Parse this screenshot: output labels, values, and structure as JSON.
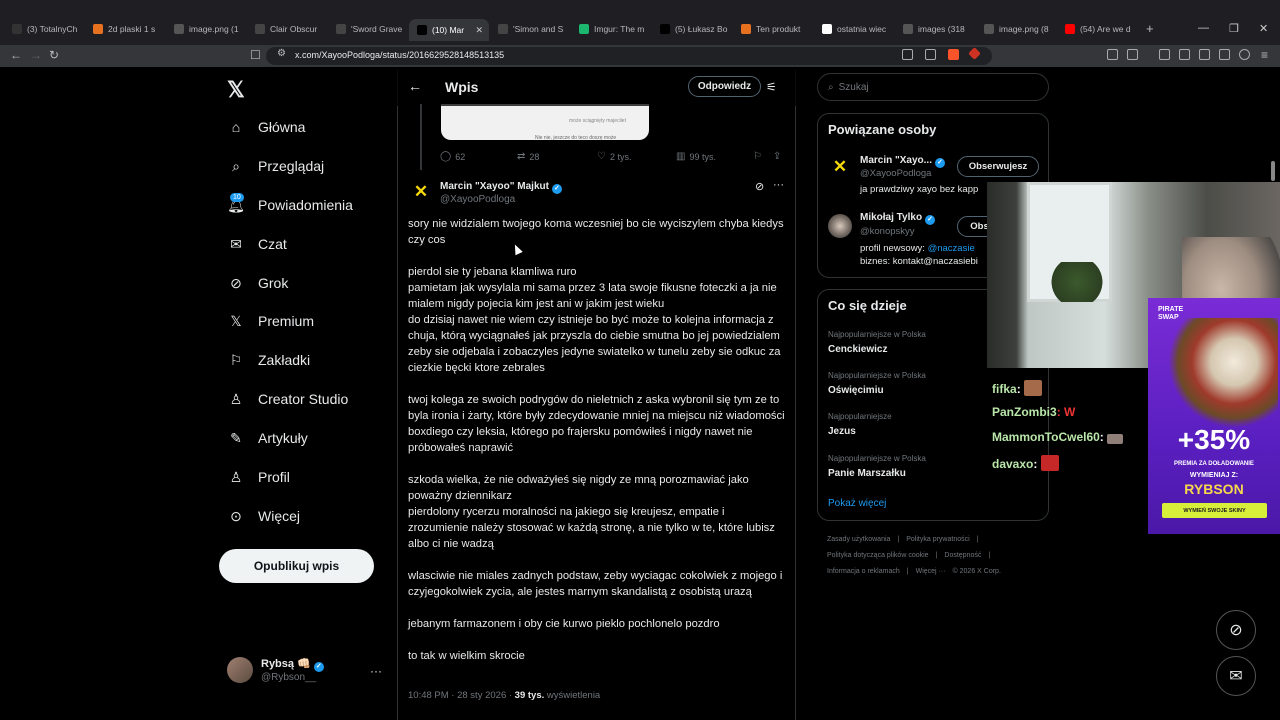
{
  "browser": {
    "tabs": [
      {
        "label": "(3) TotalnyCh",
        "color": "#333"
      },
      {
        "label": "2d plaski 1 s",
        "color": "#e8711f"
      },
      {
        "label": "image.png (1",
        "color": "#555"
      },
      {
        "label": "Clair Obscur",
        "color": "#444"
      },
      {
        "label": "'Sword Grave",
        "color": "#444"
      },
      {
        "label": "(10) Mar",
        "color": "#000"
      },
      {
        "label": "'Simon and S",
        "color": "#444"
      },
      {
        "label": "Imgur: The m",
        "color": "#1bb76e"
      },
      {
        "label": "(5) Łukasz Bo",
        "color": "#000"
      },
      {
        "label": "Ten produkt",
        "color": "#e8711f"
      },
      {
        "label": "ostatnia wiec",
        "color": "#fff"
      },
      {
        "label": "images (318",
        "color": "#555"
      },
      {
        "label": "image.png (8",
        "color": "#555"
      },
      {
        "label": "(54) Are we d",
        "color": "#f00"
      }
    ],
    "url": "x.com/XayooPodloga/status/2016629528148513135"
  },
  "nav": {
    "items": [
      {
        "label": "Główna",
        "icon": "home-icon"
      },
      {
        "label": "Przeglądaj",
        "icon": "search-icon"
      },
      {
        "label": "Powiadomienia",
        "icon": "bell-icon",
        "badge": "10"
      },
      {
        "label": "Czat",
        "icon": "mail-icon"
      },
      {
        "label": "Grok",
        "icon": "grok-icon"
      },
      {
        "label": "Premium",
        "icon": "x-icon"
      },
      {
        "label": "Zakładki",
        "icon": "bookmark-icon"
      },
      {
        "label": "Creator Studio",
        "icon": "creator-icon"
      },
      {
        "label": "Artykuły",
        "icon": "article-icon"
      },
      {
        "label": "Profil",
        "icon": "person-icon"
      },
      {
        "label": "Więcej",
        "icon": "more-circle-icon"
      }
    ],
    "post_button": "Opublikuj wpis",
    "me": {
      "name": "Rybsą 👊🏻",
      "handle": "@Rybson__"
    }
  },
  "main": {
    "title": "Wpis",
    "reply_button": "Odpowiedz",
    "preview_text_1": "może sciągnięty majecilet",
    "preview_text_2": "Nie nie, jeszcze do teco doszę może",
    "prev_actions": {
      "replies": "62",
      "reposts": "28",
      "likes": "2 tys.",
      "views": "99 tys."
    },
    "author": {
      "name": "Marcin \"Xayoo\" Majkut",
      "handle": "@XayooPodloga"
    },
    "paragraphs": [
      "sory nie widzialem twojego koma wczesniej bo cie wyciszylem chyba kiedys czy cos",
      "pierdol sie ty jebana klamliwa ruro\npamietam jak wysylala mi sama przez 3 lata swoje fikusne foteczki a ja nie mialem nigdy pojecia kim jest ani w jakim jest wieku\ndo dzisiaj nawet nie wiem czy istnieje bo być może to kolejna informacja z chuja, którą wyciągnałeś jak przyszla do ciebie smutna bo jej powiedzialem zeby sie odjebala i zobaczyles jedyne swiatelko w tunelu zeby sie odkuc za ciezkie bęcki ktore zebrales",
      "twoj kolega ze swoich podrygów do nieletnich z aska wybronil się tym ze to byla ironia i żarty, które były zdecydowanie mniej na miejscu niż wiadomości boxdiego czy leksia, którego po frajersku pomówiłeś i nigdy nawet nie próbowałeś naprawić",
      "szkoda wielka, że nie odważyłeś się nigdy ze mną porozmawiać jako poważny dziennikarz\npierdolony rycerzu moralności na jakiego się kreujesz, empatie i zrozumienie należy stosować w każdą stronę, a nie tylko w te, które lubisz albo ci nie wadzą",
      "wlasciwie nie miales zadnych podstaw, zeby wyciagac cokolwiek z mojego i czyjegokolwiek zycia, ale jestes marnym skandalistą z osobistą urazą",
      "jebanym farmazonem i oby cie kurwo pieklo pochlonelo pozdro",
      "to tak w wielkim skrocie"
    ],
    "meta": {
      "time": "10:48 PM · 28 sty 2026 · ",
      "views": "39 tys.",
      "views_label": " wyświetlenia"
    }
  },
  "right": {
    "search_placeholder": "Szukaj",
    "related_title": "Powiązane osoby",
    "people": [
      {
        "name": "Marcin \"Xayo...",
        "handle": "@XayooPodloga",
        "bio": "ja prawdziwy xayo bez kapp",
        "button": "Obserwujesz"
      },
      {
        "name": "Mikołaj Tylko",
        "handle": "@konopskyy",
        "bio_prefix": "profil newsowy: ",
        "bio_link": "@naczasie",
        "bio2": "biznes: kontakt@naczasiebi",
        "button": "Obs"
      }
    ],
    "trends_title": "Co się dzieje",
    "trends": [
      {
        "context": "Najpopularniejsze w Polska",
        "name": "Cenckiewicz"
      },
      {
        "context": "Najpopularniejsze w Polska",
        "name": "Oświęcimiu"
      },
      {
        "context": "Najpopularniejsze",
        "name": "Jezus"
      },
      {
        "context": "Najpopularniejsze w Polska",
        "name": "Panie Marszałku"
      }
    ],
    "show_more": "Pokaż więcej",
    "footer": {
      "line1": [
        "Zasady użytkowania",
        "|",
        "Polityka prywatności",
        "|"
      ],
      "line2": [
        "Polityka dotycząca plików cookie",
        "|",
        "Dostępność",
        "|"
      ],
      "line3": [
        "Informacja o reklamach",
        "|",
        "Więcej ···",
        "© 2026 X Corp."
      ]
    }
  },
  "overlay": {
    "chat": [
      {
        "user": "fifka",
        "msg": ":"
      },
      {
        "user": "PanZombi3",
        "msg": ": W"
      },
      {
        "user": "MammonToCwel60",
        "msg": ":"
      },
      {
        "user": "davaxo",
        "msg": ":"
      }
    ],
    "ad": {
      "brand_1": "PIRATE",
      "brand_2": "SWAP",
      "percent": "+35%",
      "line1": "PREMIA ZA DOŁADOWANIE",
      "line2": "WYMIENIAJ Z:",
      "line3": "RYBSON",
      "button": "WYMIEŃ SWOJE SKINY"
    }
  },
  "colors": {
    "accent": "#1d9bf0",
    "bg": "#000000",
    "muted": "#71767b"
  }
}
